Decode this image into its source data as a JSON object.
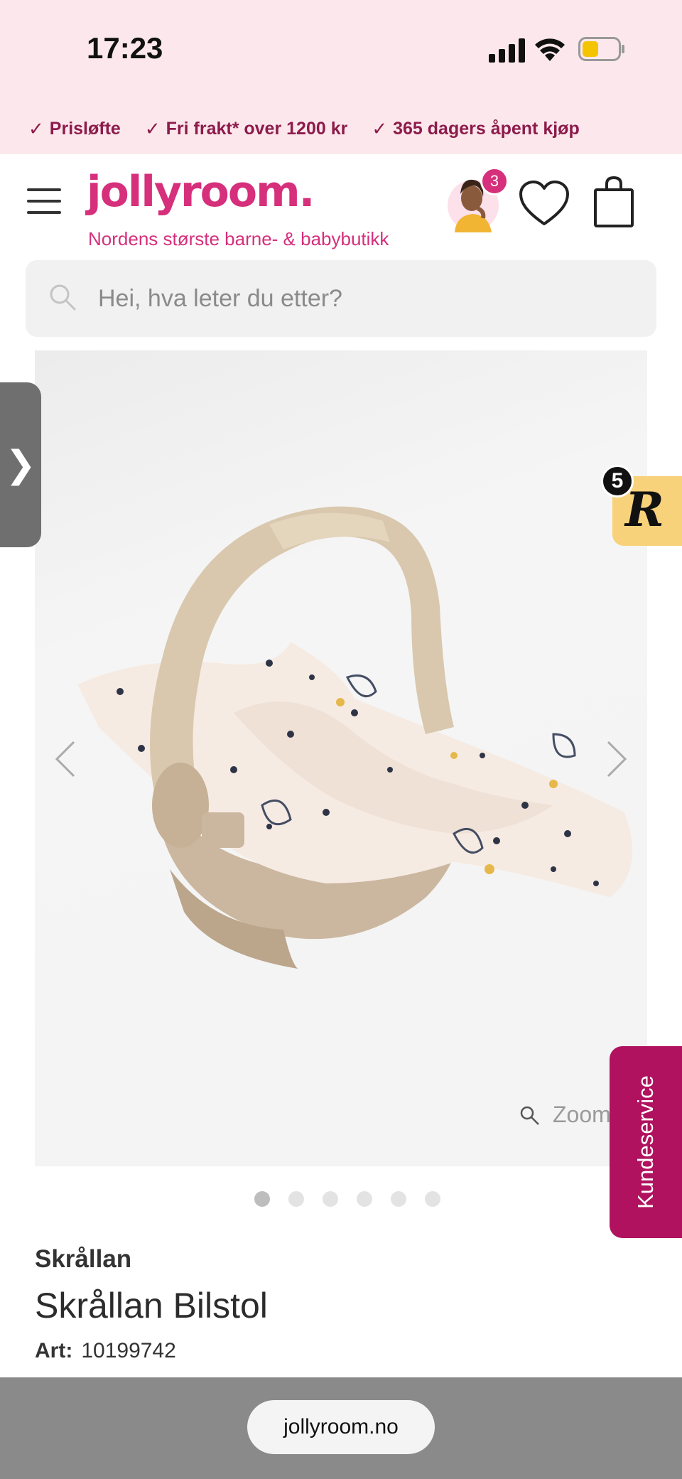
{
  "status_bar": {
    "time": "17:23"
  },
  "usp_bar": {
    "items": [
      {
        "check": "✓",
        "label": "Prisløfte"
      },
      {
        "check": "✓",
        "label": "Fri frakt* over 1200 kr"
      },
      {
        "check": "✓",
        "label": "365 dagers åpent kjøp"
      }
    ]
  },
  "header": {
    "logo": "jollyroom.",
    "tagline": "Nordens største barne- & babybutikk",
    "avatar_badge": "3",
    "icons": [
      "menu-icon",
      "heart-icon",
      "shopping-bag-icon"
    ]
  },
  "search": {
    "placeholder": "Hei, hva leter du etter?"
  },
  "gallery": {
    "zoom_label": "Zoom",
    "slide_count": 6,
    "active_slide": 1
  },
  "floating": {
    "side_handle": "❯",
    "r_badge_letter": "R",
    "r_badge_count": "5",
    "kundeservice": "Kundeservice"
  },
  "product": {
    "brand": "Skrållan",
    "title": "Skrållan Bilstol",
    "art_label": "Art:",
    "art_number": "10199742"
  },
  "browser": {
    "url": "jollyroom.no"
  },
  "colors": {
    "brand_pink": "#d62f7b",
    "usp_text": "#8c1b4b",
    "top_bg": "#fce8ec",
    "kundeservice_bg": "#b0125f",
    "r_badge_bg": "#f8d27a"
  }
}
